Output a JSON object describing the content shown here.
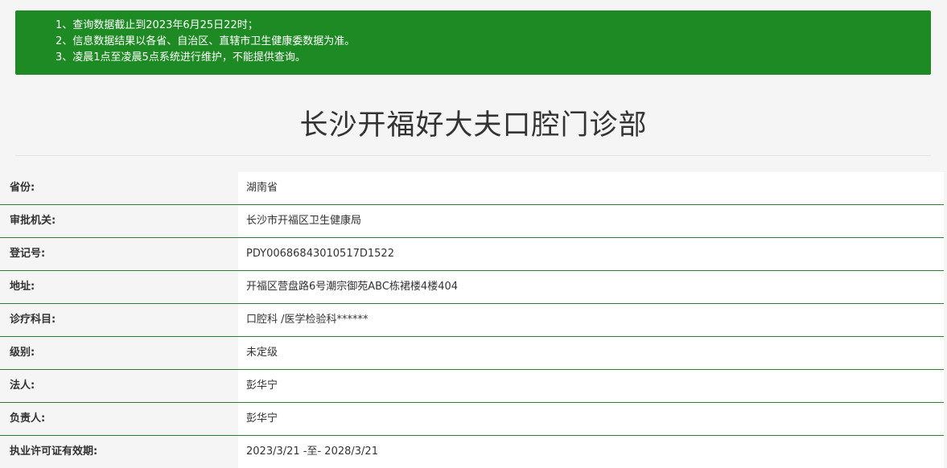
{
  "notice": {
    "lines": [
      "1、查询数据截止到2023年6月25日22时；",
      "2、信息数据结果以各省、自治区、直辖市卫生健康委数据为准。",
      "3、凌晨1点至凌晨5点系统进行维护，不能提供查询。"
    ],
    "background_color": "#1e8a23"
  },
  "title": "长沙开福好大夫口腔门诊部",
  "rows": [
    {
      "label": "省份:",
      "value": "湖南省"
    },
    {
      "label": "审批机关:",
      "value": "长沙市开福区卫生健康局"
    },
    {
      "label": "登记号:",
      "value": "PDY00686843010517D1522"
    },
    {
      "label": "地址:",
      "value": "开福区营盘路6号潮宗御苑ABC栋裙楼4楼404"
    },
    {
      "label": "诊疗科目:",
      "value": "口腔科 /医学检验科******"
    },
    {
      "label": "级别:",
      "value": "未定级"
    },
    {
      "label": "法人:",
      "value": "彭华宁"
    },
    {
      "label": "负责人:",
      "value": "彭华宁"
    },
    {
      "label": "执业许可证有效期:",
      "value": "2023/3/21 -至- 2028/3/21"
    }
  ],
  "row_divider_color": "#2e7d32"
}
